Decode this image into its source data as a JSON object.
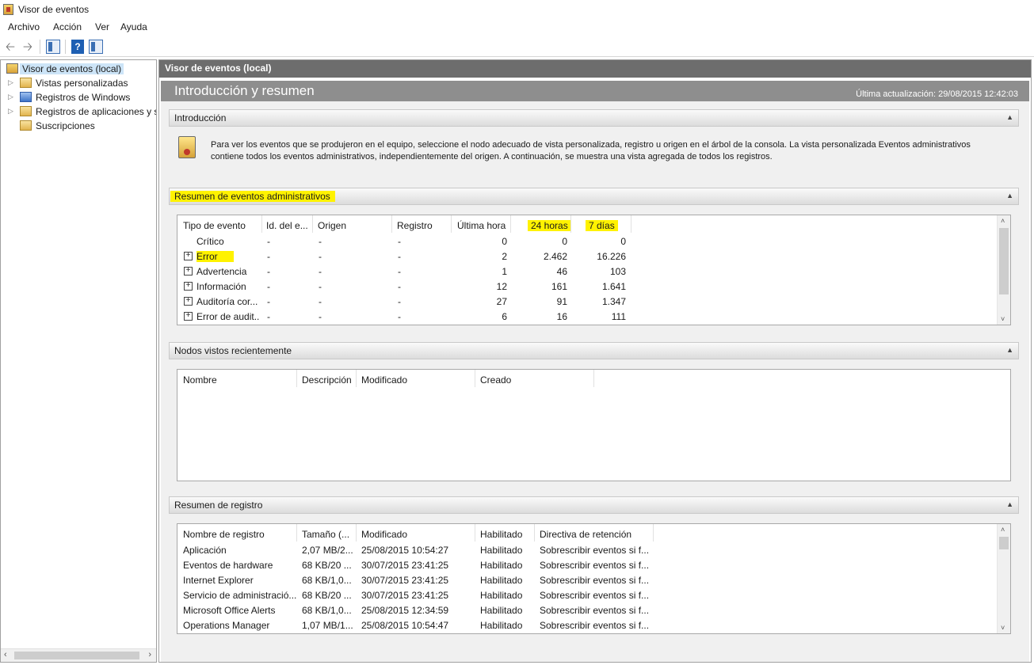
{
  "window": {
    "title": "Visor de eventos"
  },
  "menu": [
    "Archivo",
    "Acción",
    "Ver",
    "Ayuda"
  ],
  "toolbar": {
    "icons": [
      "back-arrow-icon",
      "forward-arrow-icon",
      "show-hide-tree-icon",
      "help-icon",
      "show-hide-action-pane-icon"
    ]
  },
  "tree": {
    "items": [
      {
        "label": "Visor de eventos (local)",
        "icon": "event-viewer-icon"
      },
      {
        "label": "Vistas personalizadas",
        "icon": "folder-icon"
      },
      {
        "label": "Registros de Windows",
        "icon": "windows-logs-icon"
      },
      {
        "label": "Registros de aplicaciones y s",
        "icon": "folder-icon"
      },
      {
        "label": "Suscripciones",
        "icon": "subscriptions-icon"
      }
    ]
  },
  "main": {
    "header": "Visor de eventos (local)",
    "title": "Introducción y resumen",
    "last_update": "Última actualización: 29/08/2015 12:42:03"
  },
  "intro": {
    "title": "Introducción",
    "text": "Para ver los eventos que se produjeron en el equipo, seleccione el nodo adecuado de vista personalizada, registro u origen en el árbol de la consola. La vista personalizada Eventos administrativos contiene todos los eventos administrativos, independientemente del origen. A continuación, se muestra una vista agregada de todos los registros."
  },
  "admin_summary": {
    "title": "Resumen de eventos administrativos",
    "columns": [
      "Tipo de evento",
      "Id. del e...",
      "Origen",
      "Registro",
      "Última hora",
      "24 horas",
      "7 días"
    ],
    "rows": [
      {
        "type": "Crítico",
        "id": "-",
        "origin": "-",
        "log": "-",
        "last_hour": "0",
        "h24": "0",
        "d7": "0",
        "expandable": false
      },
      {
        "type": "Error",
        "id": "-",
        "origin": "-",
        "log": "-",
        "last_hour": "2",
        "h24": "2.462",
        "d7": "16.226",
        "expandable": true
      },
      {
        "type": "Advertencia",
        "id": "-",
        "origin": "-",
        "log": "-",
        "last_hour": "1",
        "h24": "46",
        "d7": "103",
        "expandable": true
      },
      {
        "type": "Información",
        "id": "-",
        "origin": "-",
        "log": "-",
        "last_hour": "12",
        "h24": "161",
        "d7": "1.641",
        "expandable": true
      },
      {
        "type": "Auditoría cor...",
        "id": "-",
        "origin": "-",
        "log": "-",
        "last_hour": "27",
        "h24": "91",
        "d7": "1.347",
        "expandable": true
      },
      {
        "type": "Error de audit...",
        "id": "-",
        "origin": "-",
        "log": "-",
        "last_hour": "6",
        "h24": "16",
        "d7": "111",
        "expandable": true
      }
    ]
  },
  "recent_nodes": {
    "title": "Nodos vistos recientemente",
    "columns": [
      "Nombre",
      "Descripción",
      "Modificado",
      "Creado"
    ]
  },
  "log_summary": {
    "title": "Resumen de registro",
    "columns": [
      "Nombre de registro",
      "Tamaño (...",
      "Modificado",
      "Habilitado",
      "Directiva de retención"
    ],
    "rows": [
      {
        "name": "Aplicación",
        "size": "2,07 MB/2...",
        "modified": "25/08/2015 10:54:27",
        "enabled": "Habilitado",
        "policy": "Sobrescribir eventos si f..."
      },
      {
        "name": "Eventos de hardware",
        "size": "68 KB/20 ...",
        "modified": "30/07/2015 23:41:25",
        "enabled": "Habilitado",
        "policy": "Sobrescribir eventos si f..."
      },
      {
        "name": "Internet Explorer",
        "size": "68 KB/1,0...",
        "modified": "30/07/2015 23:41:25",
        "enabled": "Habilitado",
        "policy": "Sobrescribir eventos si f..."
      },
      {
        "name": "Servicio de administració...",
        "size": "68 KB/20 ...",
        "modified": "30/07/2015 23:41:25",
        "enabled": "Habilitado",
        "policy": "Sobrescribir eventos si f..."
      },
      {
        "name": "Microsoft Office Alerts",
        "size": "68 KB/1,0...",
        "modified": "25/08/2015 12:34:59",
        "enabled": "Habilitado",
        "policy": "Sobrescribir eventos si f..."
      },
      {
        "name": "Operations Manager",
        "size": "1,07 MB/1...",
        "modified": "25/08/2015 10:54:47",
        "enabled": "Habilitado",
        "policy": "Sobrescribir eventos si f..."
      }
    ]
  },
  "highlight_color": "#fff200"
}
